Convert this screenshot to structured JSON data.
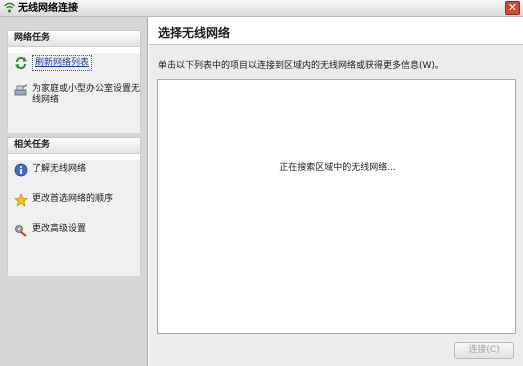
{
  "window": {
    "title": "无线网络连接",
    "close_label": "✕"
  },
  "sidebar": {
    "network_tasks": {
      "header": "网络任务",
      "items": [
        {
          "label": "刷新网络列表",
          "icon": "refresh-icon"
        },
        {
          "label": "为家庭或小型办公室设置无线网络",
          "icon": "setup-network-icon"
        }
      ]
    },
    "related_tasks": {
      "header": "相关任务",
      "items": [
        {
          "label": "了解无线网络",
          "icon": "info-icon"
        },
        {
          "label": "更改首选网络的顺序",
          "icon": "star-icon"
        },
        {
          "label": "更改高级设置",
          "icon": "settings-icon"
        }
      ]
    }
  },
  "main": {
    "title": "选择无线网络",
    "instruction": "单击以下列表中的项目以连接到区域内的无线网络或获得更多信息(W)。",
    "list_status": "正在搜索区域中的无线网络...",
    "connect_label": "连接(C)"
  },
  "colors": {
    "accent": "#1f3d9c",
    "list_border": "#8cb0c9",
    "close_red": "#d24a2c"
  }
}
